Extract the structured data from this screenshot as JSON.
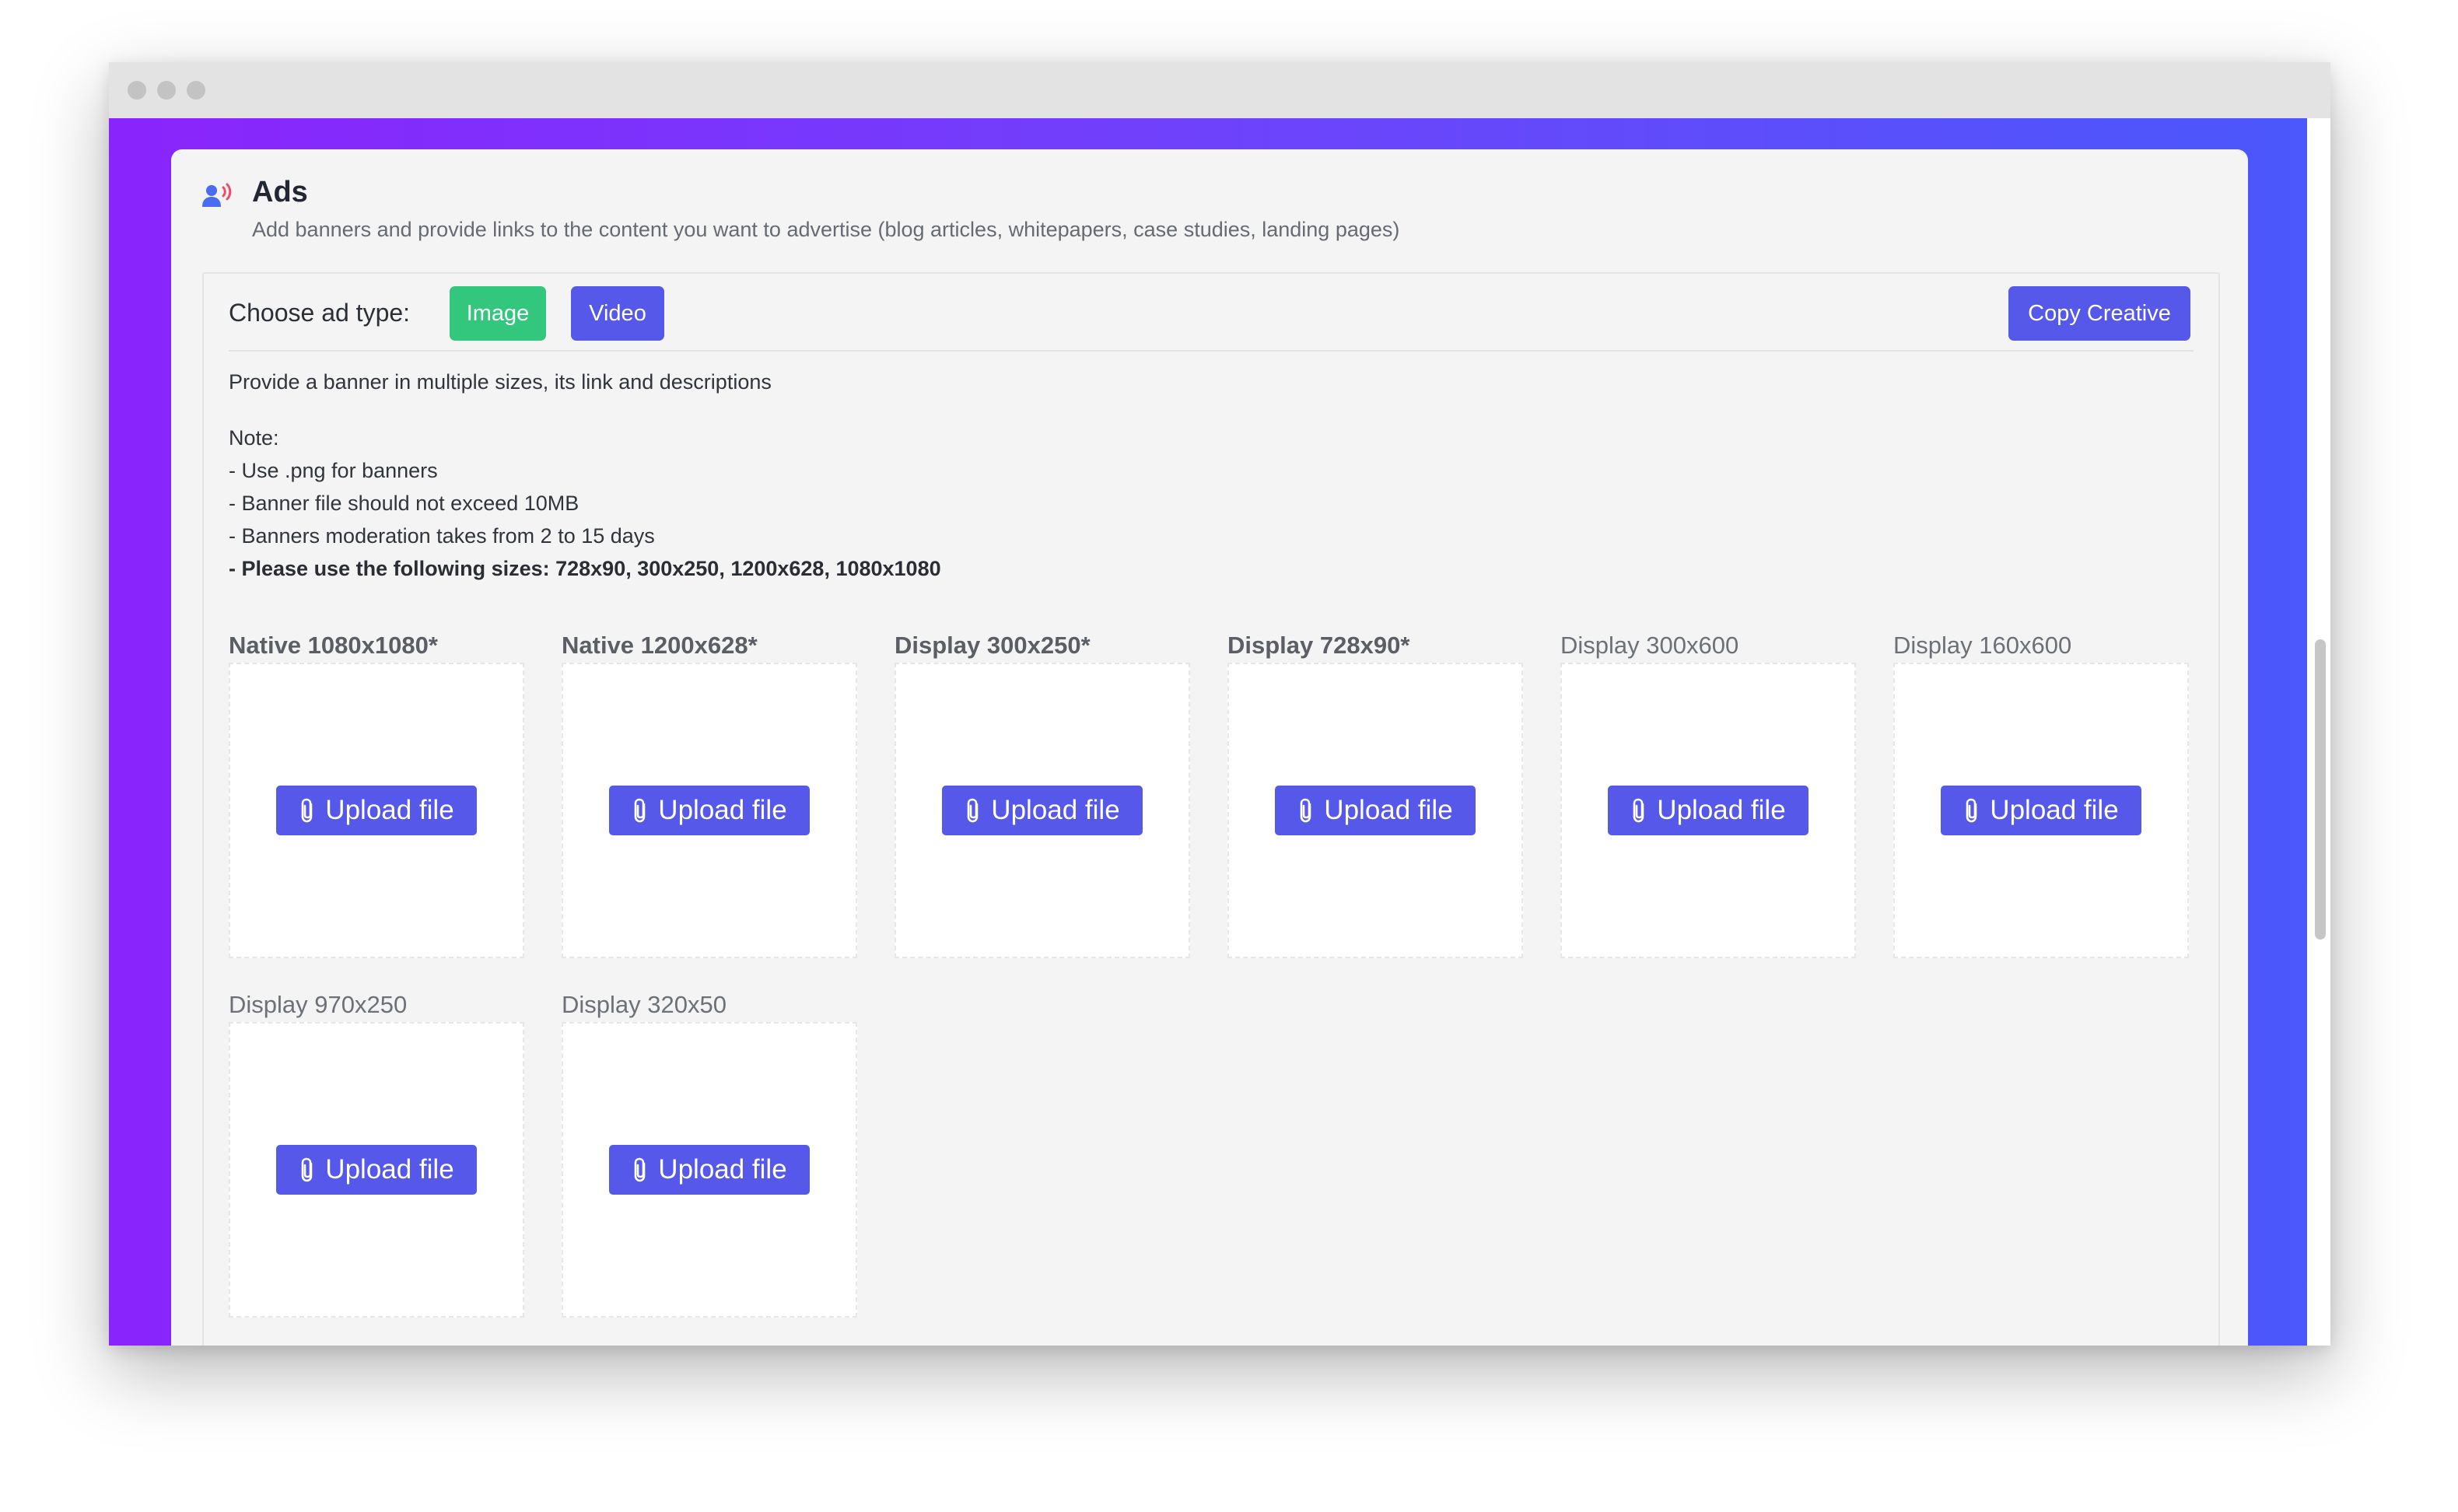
{
  "colors": {
    "gradient_start": "#8a24fc",
    "gradient_end": "#4a58fb",
    "image_button": "#33c77d",
    "primary_button": "#5658ea",
    "panel_bg": "#f4f4f4"
  },
  "header": {
    "icon": "megaphone-user-icon",
    "title": "Ads",
    "subtitle": "Add banners and provide links to the content you want to advertise (blog articles, whitepapers, case studies, landing pages)"
  },
  "toolbar": {
    "choose_label": "Choose ad type:",
    "image_label": "Image",
    "video_label": "Video",
    "copy_label": "Copy Creative"
  },
  "instructions": {
    "intro": "Provide a banner in multiple sizes, its link and descriptions",
    "note_title": "Note:",
    "notes": [
      "- Use .png for banners",
      "- Banner file should not exceed 10MB",
      "- Banners moderation takes from 2 to 15 days"
    ],
    "sizes_note": "- Please use the following sizes: 728x90, 300x250, 1200x628, 1080x1080"
  },
  "upload_label": "Upload file",
  "upload_icon": "paperclip-icon",
  "slots": [
    {
      "label": "Native 1080x1080*",
      "required": true
    },
    {
      "label": "Native 1200x628*",
      "required": true
    },
    {
      "label": "Display 300x250*",
      "required": true
    },
    {
      "label": "Display 728x90*",
      "required": true
    },
    {
      "label": "Display 300x600",
      "required": false
    },
    {
      "label": "Display 160x600",
      "required": false
    },
    {
      "label": "Display 970x250",
      "required": false
    },
    {
      "label": "Display 320x50",
      "required": false
    }
  ]
}
